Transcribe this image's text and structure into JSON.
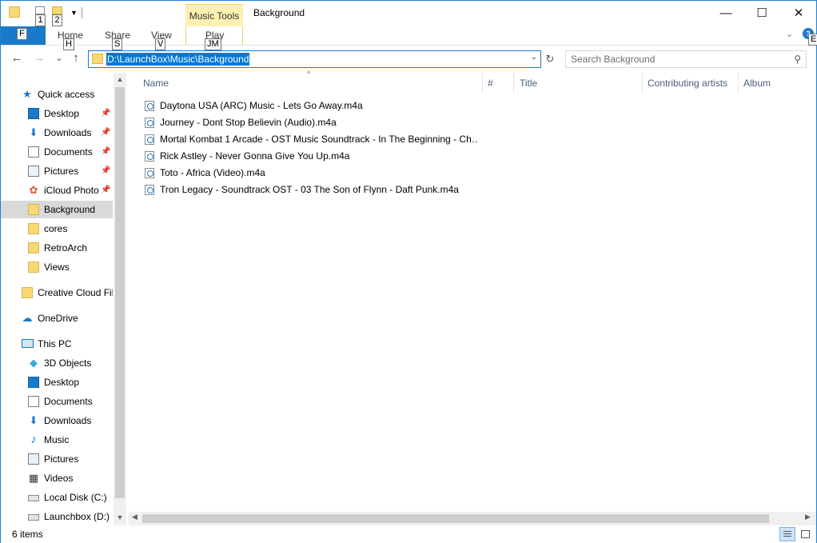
{
  "titlebar": {
    "context_tab": "Music Tools",
    "title": "Background",
    "qat_keytips": [
      "1",
      "2"
    ],
    "minimize": "—",
    "maximize": "☐",
    "close": "✕"
  },
  "ribbon": {
    "file_keytip": "F",
    "tabs": [
      {
        "label": "Home",
        "keytip": "H"
      },
      {
        "label": "Share",
        "keytip": "S"
      },
      {
        "label": "View",
        "keytip": "V"
      },
      {
        "label": "Play",
        "keytip": "JM"
      }
    ],
    "help_glyph": "?",
    "help_keytip": "E"
  },
  "navigation": {
    "back": "←",
    "forward": "→",
    "recent": "⌄",
    "up": "↑",
    "address_path": "D:\\LaunchBox\\Music\\Background",
    "refresh": "↻",
    "search_placeholder": "Search Background",
    "search_icon": "⚲"
  },
  "sidebar": {
    "items": [
      {
        "label": "Quick access",
        "icon": "star-icon",
        "glyph": "★"
      },
      {
        "label": "Desktop",
        "icon": "desktop-icon",
        "pinned": true
      },
      {
        "label": "Downloads",
        "icon": "download-icon",
        "glyph": "⬇",
        "pinned": true
      },
      {
        "label": "Documents",
        "icon": "documents-icon",
        "pinned": true
      },
      {
        "label": "Pictures",
        "icon": "pictures-icon",
        "pinned": true
      },
      {
        "label": "iCloud Photo",
        "icon": "icloud-photos-icon",
        "glyph": "✿",
        "pinned": true
      },
      {
        "label": "Background",
        "icon": "folder-icon",
        "selected": true
      },
      {
        "label": "cores",
        "icon": "folder-icon"
      },
      {
        "label": "RetroArch",
        "icon": "folder-icon"
      },
      {
        "label": "Views",
        "icon": "folder-icon"
      },
      {
        "label": "Creative Cloud Fil",
        "icon": "creative-cloud-icon"
      },
      {
        "label": "OneDrive",
        "icon": "onedrive-icon",
        "glyph": "☁"
      },
      {
        "label": "This PC",
        "icon": "computer-icon",
        "glyph": "🖥"
      },
      {
        "label": "3D Objects",
        "icon": "cube-icon",
        "glyph": "◆"
      },
      {
        "label": "Desktop",
        "icon": "desktop-icon"
      },
      {
        "label": "Documents",
        "icon": "documents-icon"
      },
      {
        "label": "Downloads",
        "icon": "download-icon",
        "glyph": "⬇"
      },
      {
        "label": "Music",
        "icon": "music-icon",
        "glyph": "♪"
      },
      {
        "label": "Pictures",
        "icon": "pictures-icon"
      },
      {
        "label": "Videos",
        "icon": "videos-icon",
        "glyph": "▦"
      },
      {
        "label": "Local Disk (C:)",
        "icon": "drive-icon"
      },
      {
        "label": "Launchbox (D:)",
        "icon": "drive-icon"
      }
    ],
    "pin_glyph": "📌"
  },
  "filelist": {
    "columns": [
      "Name",
      "#",
      "Title",
      "Contributing artists",
      "Album"
    ],
    "sort_indicator": "^",
    "files": [
      "Daytona USA (ARC) Music - Lets Go Away.m4a",
      "Journey - Dont Stop Believin (Audio).m4a",
      "Mortal Kombat 1 Arcade - OST Music Soundtrack - In The Beginning - Ch…",
      "Rick Astley - Never Gonna Give You Up.m4a",
      "Toto - Africa (Video).m4a",
      "Tron Legacy - Soundtrack OST - 03 The Son of Flynn - Daft Punk.m4a"
    ]
  },
  "status": {
    "item_count": "6 items"
  },
  "colors": {
    "accent": "#1979ca",
    "selection": "#0078d7",
    "context_tab": "#fcf0b2",
    "folder": "#f8d775",
    "nav_selected": "#d9d9d9"
  }
}
